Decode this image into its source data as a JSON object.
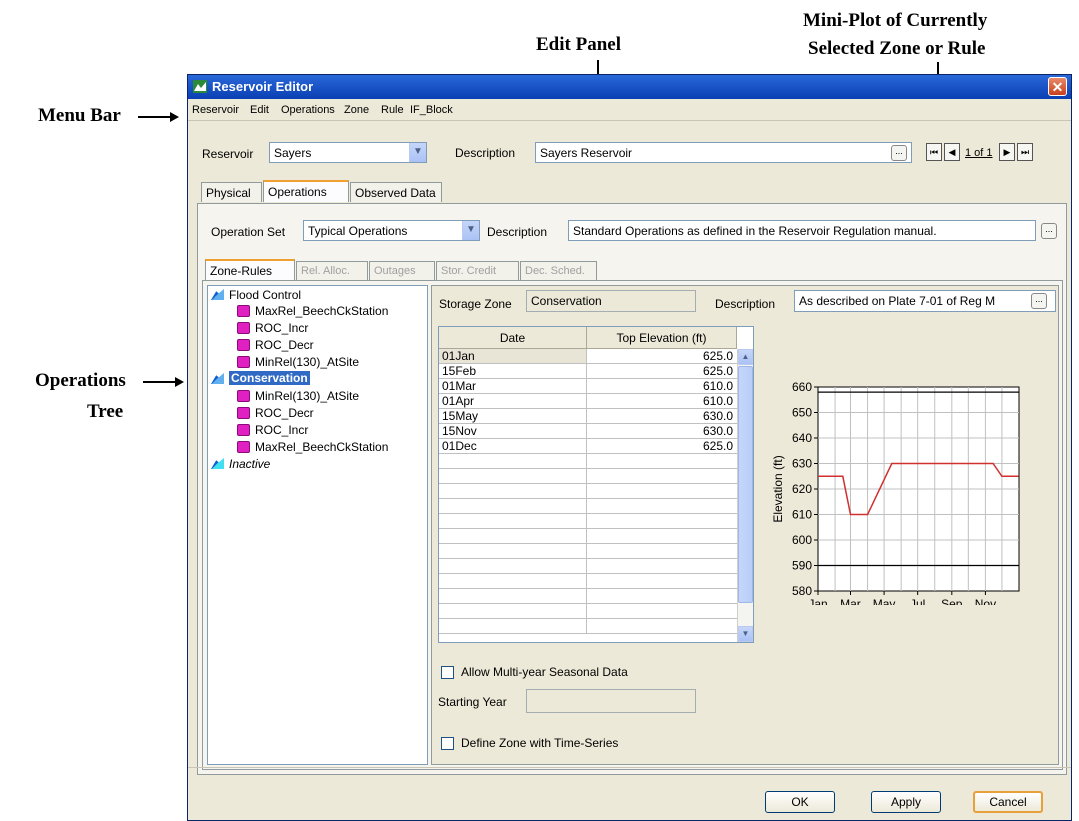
{
  "annotations": {
    "menu_bar": "Menu Bar",
    "edit_panel": "Edit Panel",
    "mini_plot_line1": "Mini-Plot of Currently",
    "mini_plot_line2": "Selected Zone or Rule",
    "ops_tree_line1": "Operations",
    "ops_tree_line2": "Tree"
  },
  "window": {
    "title": "Reservoir Editor",
    "close": "✕"
  },
  "menu": [
    "Reservoir",
    "Edit",
    "Operations",
    "Zone",
    "Rule",
    "IF_Block"
  ],
  "reservoir": {
    "label": "Reservoir",
    "value": "Sayers",
    "description_label": "Description",
    "description": "Sayers Reservoir",
    "nav_text": "1 of 1"
  },
  "main_tabs": [
    "Physical",
    "Operations",
    "Observed Data"
  ],
  "operation_set": {
    "label": "Operation Set",
    "value": "Typical Operations",
    "description_label": "Description",
    "description": "Standard Operations as defined in the Reservoir Regulation manual."
  },
  "sub_tabs": [
    "Zone-Rules",
    "Rel. Alloc.",
    "Outages",
    "Stor. Credit",
    "Dec. Sched."
  ],
  "tree": [
    {
      "type": "zone",
      "label": "Flood Control"
    },
    {
      "type": "rule",
      "label": "MaxRel_BeechCkStation"
    },
    {
      "type": "rule",
      "label": "ROC_Incr"
    },
    {
      "type": "rule",
      "label": "ROC_Decr"
    },
    {
      "type": "rule",
      "label": "MinRel(130)_AtSite"
    },
    {
      "type": "zone",
      "label": "Conservation",
      "selected": true
    },
    {
      "type": "rule",
      "label": "MinRel(130)_AtSite"
    },
    {
      "type": "rule",
      "label": "ROC_Decr"
    },
    {
      "type": "rule",
      "label": "ROC_Incr"
    },
    {
      "type": "rule",
      "label": "MaxRel_BeechCkStation"
    },
    {
      "type": "zone",
      "label": "Inactive",
      "italic": true
    }
  ],
  "edit": {
    "storage_zone_label": "Storage Zone",
    "storage_zone_value": "Conservation",
    "description_label": "Description",
    "description_value": "As described on Plate 7-01 of Reg M",
    "col_date": "Date",
    "col_elev": "Top Elevation (ft)",
    "rows": [
      {
        "date": "01Jan",
        "elev": "625.0"
      },
      {
        "date": "15Feb",
        "elev": "625.0"
      },
      {
        "date": "01Mar",
        "elev": "610.0"
      },
      {
        "date": "01Apr",
        "elev": "610.0"
      },
      {
        "date": "15May",
        "elev": "630.0"
      },
      {
        "date": "15Nov",
        "elev": "630.0"
      },
      {
        "date": "01Dec",
        "elev": "625.0"
      }
    ],
    "multi_year_label": "Allow Multi-year Seasonal Data",
    "starting_year_label": "Starting Year",
    "time_series_label": "Define Zone with Time-Series"
  },
  "chart_data": {
    "type": "line",
    "title": "",
    "xlabel": "",
    "ylabel": "Elevation (ft)",
    "x_ticks": [
      "Jan",
      "Mar",
      "May",
      "Jul",
      "Sep",
      "Nov"
    ],
    "y_ticks": [
      "660",
      "650",
      "640",
      "630",
      "620",
      "610",
      "600",
      "590",
      "580"
    ],
    "ylim": [
      580,
      660
    ],
    "series": [
      {
        "color": "#d03030",
        "x": [
          "01Jan",
          "15Feb",
          "01Mar",
          "01Apr",
          "15May",
          "15Nov",
          "01Dec",
          "31Dec"
        ],
        "y": [
          625,
          625,
          610,
          610,
          630,
          630,
          625,
          625
        ]
      }
    ],
    "hlines": [
      {
        "y": 658,
        "color": "#000000"
      },
      {
        "y": 590,
        "color": "#000000"
      }
    ],
    "grid": true
  },
  "buttons": {
    "ok": "OK",
    "apply": "Apply",
    "cancel": "Cancel"
  }
}
